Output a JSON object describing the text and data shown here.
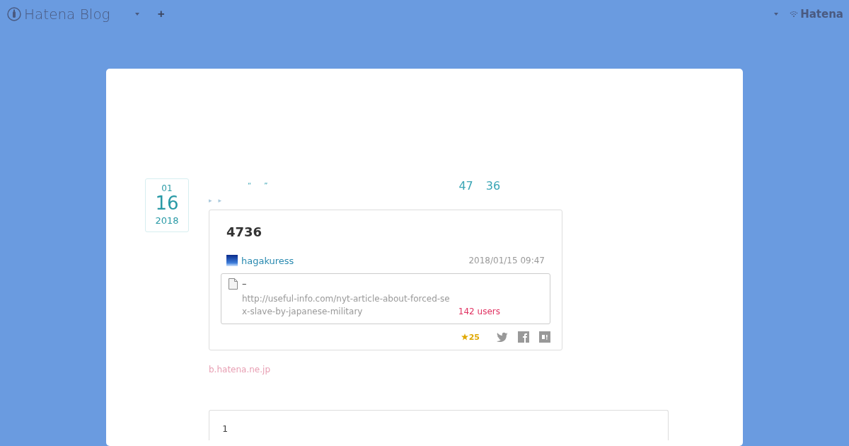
{
  "header": {
    "logo": "Hatena Blog",
    "plus": "+",
    "account": "Hatena"
  },
  "entry": {
    "date": {
      "month": "01",
      "day": "16",
      "year": "2018"
    },
    "title_parts": [
      "“",
      "”",
      "47",
      "36"
    ],
    "breadcrumb": [
      "▸",
      "▸"
    ],
    "embed": {
      "title": "4736",
      "author": "hagakuress",
      "timestamp": "2018/01/15 09:47",
      "link": {
        "title": "–",
        "url_lines": [
          "http://useful-info.com/nyt-article-about-forced-se",
          "x-slave-by-japanese-military"
        ],
        "users": "142 users"
      },
      "stars": "25"
    },
    "source": "b.hatena.ne.jp",
    "code_lines": [
      "1"
    ]
  }
}
